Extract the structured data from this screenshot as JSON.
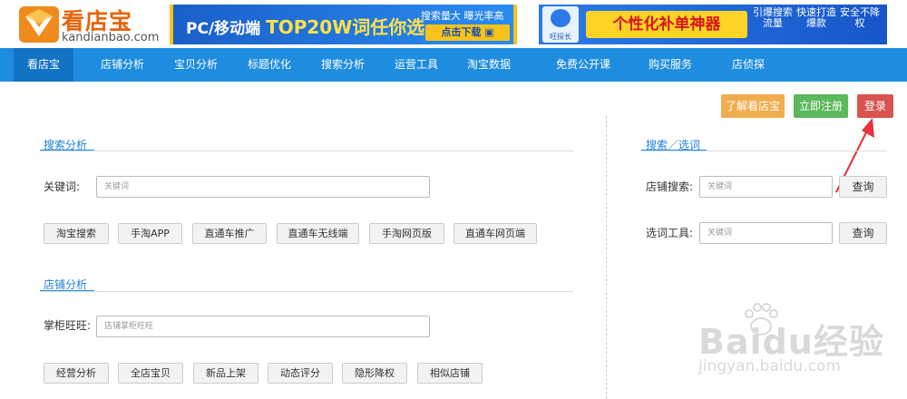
{
  "logo": {
    "name": "看店宝",
    "domain": "kandianbao.com"
  },
  "banner1": {
    "prefix": "PC/移动端",
    "highlight": "TOP20W词任你选",
    "tagline": "搜索量大 曝光率高",
    "button": "点击下载"
  },
  "banner2": {
    "icon_label": "旺探长",
    "headline": "个性化补单神器",
    "features": [
      "引爆搜索流量",
      "快速打造爆款",
      "安全不降权"
    ]
  },
  "nav": {
    "items": [
      "看店宝",
      "店铺分析",
      "宝贝分析",
      "标题优化",
      "搜索分析",
      "运营工具",
      "淘宝数据",
      "免费公开课",
      "购买服务",
      "店侦探"
    ]
  },
  "top_buttons": {
    "learn": "了解看店宝",
    "register": "立即注册",
    "login": "登录"
  },
  "search_section": {
    "title": "搜索分析",
    "keyword_label": "关键词:",
    "keyword_placeholder": "关键词",
    "chips": [
      "淘宝搜索",
      "手淘APP",
      "直通车推广",
      "直通车无线端",
      "手淘网页版",
      "直通车网页端"
    ]
  },
  "shop_section": {
    "title": "店铺分析",
    "label": "掌柜旺旺:",
    "placeholder": "店铺掌柜旺旺",
    "chips": [
      "经营分析",
      "全店宝贝",
      "新品上架",
      "动态评分",
      "隐形降权",
      "相似店铺"
    ]
  },
  "right_section": {
    "title": "搜索／选词",
    "shop_search_label": "店铺搜索:",
    "shop_search_placeholder": "关键词",
    "word_tool_label": "选词工具:",
    "word_tool_placeholder": "关键词",
    "query_label": "查询"
  },
  "watermark": {
    "text": "Baidu经验",
    "sub": "jingyan.baidu.com"
  },
  "colors": {
    "nav_bg": "#1e8de0",
    "nav_active": "#1273c5",
    "learn_btn": "#f0ad4e",
    "register_btn": "#5cb85c",
    "login_btn": "#d9534f",
    "arrow": "#e8323c",
    "logo_orange": "#e8630a"
  }
}
